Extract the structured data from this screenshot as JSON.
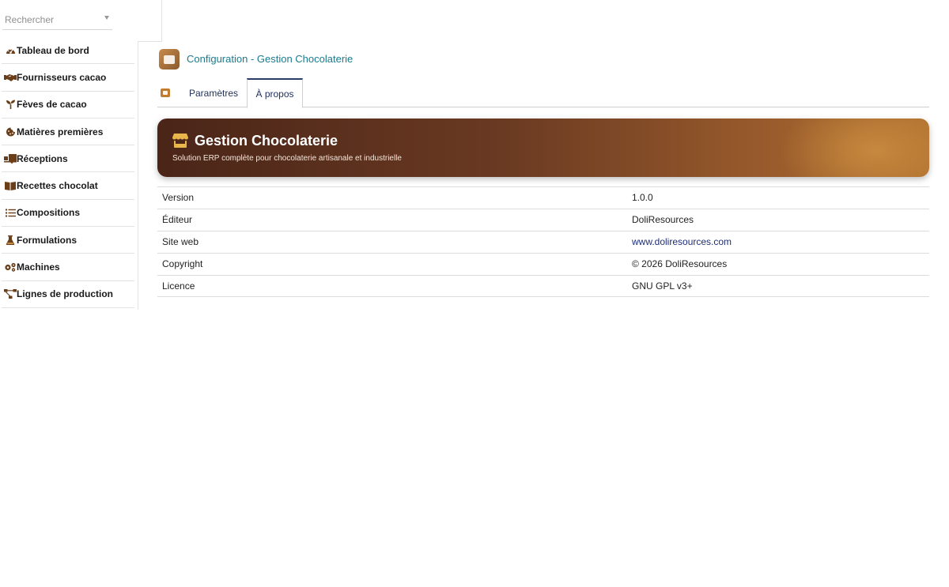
{
  "search": {
    "placeholder": "Rechercher"
  },
  "sidebar": {
    "items": [
      {
        "label": "Tableau de bord",
        "icon": "dashboard-gauge-icon"
      },
      {
        "label": "Fournisseurs cacao",
        "icon": "handshake-icon"
      },
      {
        "label": "Fèves de cacao",
        "icon": "seedling-icon"
      },
      {
        "label": "Matières premières",
        "icon": "cookie-icon"
      },
      {
        "label": "Réceptions",
        "icon": "truck-loading-icon"
      },
      {
        "label": "Recettes chocolat",
        "icon": "open-book-icon"
      },
      {
        "label": "Compositions",
        "icon": "list-icon"
      },
      {
        "label": "Formulations",
        "icon": "flask-icon"
      },
      {
        "label": "Machines",
        "icon": "cogs-icon"
      },
      {
        "label": "Lignes de production",
        "icon": "project-diagram-icon"
      }
    ]
  },
  "header": {
    "title": "Configuration - Gestion Chocolaterie"
  },
  "tabs": [
    {
      "label": "Paramètres",
      "active": false
    },
    {
      "label": "À propos",
      "active": true
    }
  ],
  "banner": {
    "title": "Gestion Chocolaterie",
    "subtitle": "Solution ERP complète pour chocolaterie artisanale et industrielle",
    "icon": "store-icon"
  },
  "info": {
    "rows": [
      {
        "key": "Version",
        "value": "1.0.0"
      },
      {
        "key": "Éditeur",
        "value": "DoliResources"
      },
      {
        "key": "Site web",
        "value": "www.doliresources.com"
      },
      {
        "key": "Copyright",
        "value": "© 2026 DoliResources"
      },
      {
        "key": "Licence",
        "value": "GNU GPL v3+"
      }
    ]
  },
  "colors": {
    "accent_brown": "#6b3e1a",
    "title_teal": "#1a7b8d",
    "link_navy": "#1d2d7a",
    "banner_start": "#4a2518",
    "banner_end": "#b0712f"
  }
}
